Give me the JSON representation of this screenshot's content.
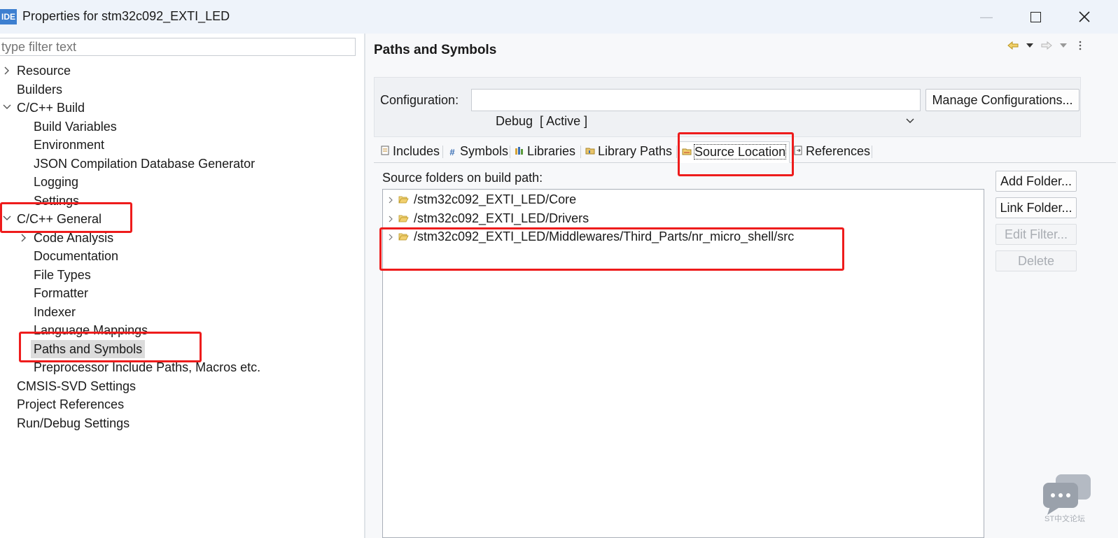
{
  "window": {
    "app_badge": "IDE",
    "title": "Properties for stm32c092_EXTI_LED"
  },
  "left": {
    "filter_placeholder": "type filter text",
    "tree": [
      {
        "label": "Resource",
        "twisty": ">"
      },
      {
        "label": "Builders",
        "twisty": ""
      },
      {
        "label": "C/C++ Build",
        "twisty": "v"
      },
      {
        "label": "Build Variables",
        "twisty": ""
      },
      {
        "label": "Environment",
        "twisty": ""
      },
      {
        "label": "JSON Compilation Database Generator",
        "twisty": ""
      },
      {
        "label": "Logging",
        "twisty": ""
      },
      {
        "label": "Settings",
        "twisty": ""
      },
      {
        "label": "C/C++ General",
        "twisty": "v"
      },
      {
        "label": "Code Analysis",
        "twisty": ">"
      },
      {
        "label": "Documentation",
        "twisty": ""
      },
      {
        "label": "File Types",
        "twisty": ""
      },
      {
        "label": "Formatter",
        "twisty": ""
      },
      {
        "label": "Indexer",
        "twisty": ""
      },
      {
        "label": "Language Mappings",
        "twisty": ""
      },
      {
        "label": "Paths and Symbols",
        "twisty": "",
        "selected": true
      },
      {
        "label": "Preprocessor Include Paths, Macros etc.",
        "twisty": ""
      },
      {
        "label": "CMSIS-SVD Settings",
        "twisty": ""
      },
      {
        "label": "Project References",
        "twisty": ""
      },
      {
        "label": "Run/Debug Settings",
        "twisty": ""
      }
    ]
  },
  "right": {
    "page_title": "Paths and Symbols",
    "config_label": "Configuration:",
    "config_value": "Debug  [ Active ]",
    "manage_button": "Manage Configurations...",
    "tabs": [
      {
        "label": "Includes",
        "icon": "include-icon"
      },
      {
        "label": "Symbols",
        "icon": "hash-icon"
      },
      {
        "label": "Libraries",
        "icon": "library-icon"
      },
      {
        "label": "Library Paths",
        "icon": "library-path-icon"
      },
      {
        "label": "Source Location",
        "icon": "source-folder-icon",
        "active": true
      },
      {
        "label": "References",
        "icon": "references-icon"
      }
    ],
    "source_folders_label": "Source folders on build path:",
    "source_folders": [
      "/stm32c092_EXTI_LED/Core",
      "/stm32c092_EXTI_LED/Drivers",
      "/stm32c092_EXTI_LED/Middlewares/Third_Parts/nr_micro_shell/src"
    ],
    "buttons": {
      "add_folder": "Add Folder...",
      "link_folder": "Link Folder...",
      "edit_filter": "Edit Filter...",
      "delete": "Delete"
    }
  },
  "watermark": {
    "text": "ST中文论坛"
  },
  "colors": {
    "highlight": "#ee1c1c",
    "selection": "#dcdcdc",
    "app_badge": "#3d7fd0"
  }
}
